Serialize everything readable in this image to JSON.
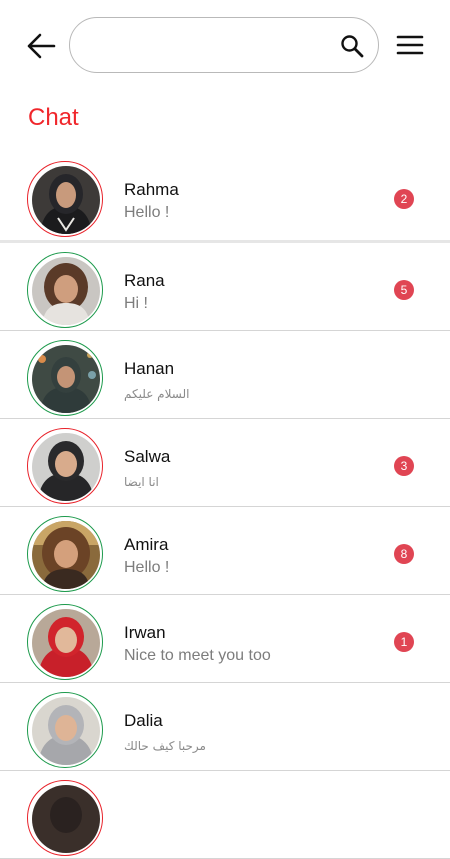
{
  "header": {
    "back_icon": "arrow-left-icon",
    "search": {
      "placeholder": "",
      "value": "",
      "icon": "search-icon"
    },
    "menu_icon": "hamburger-menu-icon"
  },
  "page_title": "Chat",
  "colors": {
    "accent": "#f0262b",
    "badge": "#e04553",
    "ring_green": "#1d9a4c",
    "ring_red": "#e8222a"
  },
  "chats": [
    {
      "name": "Rahma",
      "message": "Hello !",
      "unread": "2",
      "ring": "red"
    },
    {
      "name": "Rana",
      "message": "Hi !",
      "unread": "5",
      "ring": "green"
    },
    {
      "name": "Hanan",
      "message": "السلام عليكم",
      "unread": "",
      "ring": "green"
    },
    {
      "name": "Salwa",
      "message": "انا ايضا",
      "unread": "3",
      "ring": "red"
    },
    {
      "name": "Amira",
      "message": "Hello !",
      "unread": "8",
      "ring": "green"
    },
    {
      "name": "Irwan",
      "message": "Nice to meet you too",
      "unread": "1",
      "ring": "green"
    },
    {
      "name": "Dalia",
      "message": "مرحبا كيف حالك",
      "unread": "",
      "ring": "green"
    },
    {
      "name": "",
      "message": "",
      "unread": "",
      "ring": "red"
    }
  ]
}
